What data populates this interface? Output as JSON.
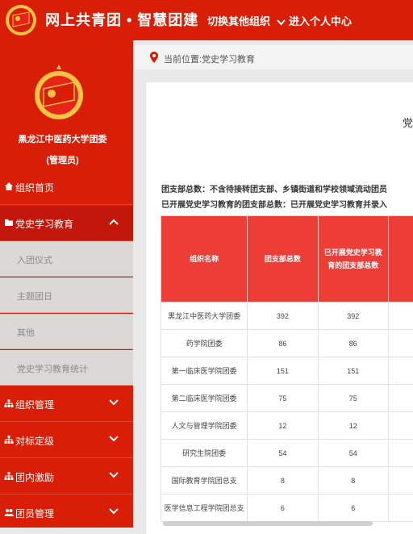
{
  "header": {
    "title": "网上共青团 • 智慧团建",
    "switch_org": "切换其他组织",
    "personal_center": "进入个人中心"
  },
  "sidebar": {
    "org_name": "黑龙江中医药大学团委",
    "org_role": "(管理员)",
    "items": [
      {
        "label": "组织首页",
        "icon": "home-icon"
      },
      {
        "label": "党史学习教育",
        "icon": "folder-open-icon",
        "expanded": true
      },
      {
        "label": "组织管理",
        "icon": "sitemap-icon"
      },
      {
        "label": "对标定级",
        "icon": "sitemap-icon"
      },
      {
        "label": "团内激励",
        "icon": "sitemap-icon"
      },
      {
        "label": "团员管理",
        "icon": "users-icon"
      }
    ],
    "sub_items": [
      "入团仪式",
      "主题团日",
      "其他",
      "党史学习教育统计"
    ]
  },
  "breadcrumb": {
    "label": "当前位置:党史学习教育"
  },
  "report": {
    "title_fragment": "党",
    "note1": "团支部总数：不含待接转团支部、乡镇街道和学校领域流动团员",
    "note2": "已开展党史学习教育的团支部总数：已开展党史学习教育并录入"
  },
  "table": {
    "headers": [
      "组织名称",
      "团支部总数",
      "已开展党史学习教育的团支部总数"
    ],
    "rows": [
      [
        "黑龙江中医药大学团委",
        "392",
        "392"
      ],
      [
        "药学院团委",
        "86",
        "86"
      ],
      [
        "第一临床医学院团委",
        "151",
        "151"
      ],
      [
        "第二临床医学院团委",
        "75",
        "75"
      ],
      [
        "人文与管理学院团委",
        "12",
        "12"
      ],
      [
        "研究生院团委",
        "54",
        "54"
      ],
      [
        "国际教育学院团总支",
        "8",
        "8"
      ],
      [
        "医学信息工程学院团总支",
        "6",
        "6"
      ]
    ]
  },
  "colors": {
    "brand_red": "#d81e06",
    "header_red": "#ec3d37"
  }
}
